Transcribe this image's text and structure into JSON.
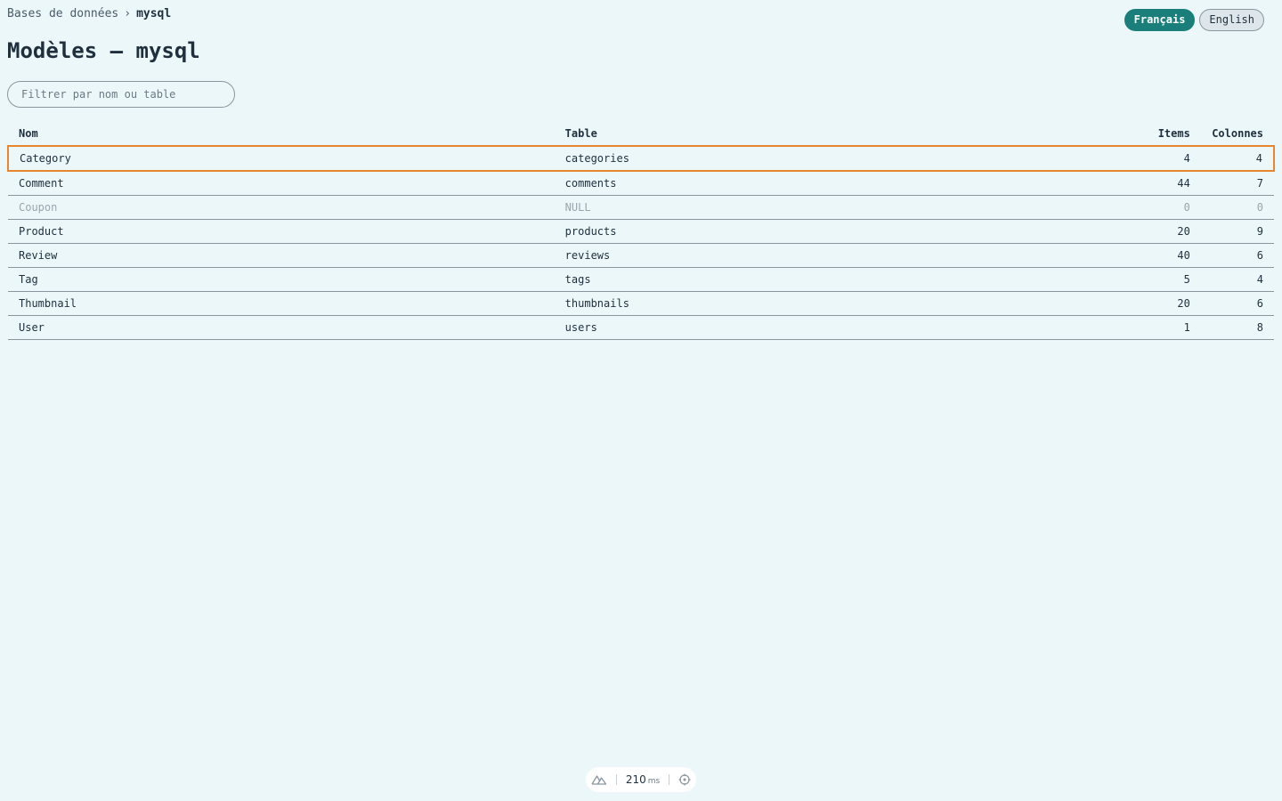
{
  "breadcrumb": {
    "root": "Bases de données",
    "separator": "›",
    "current": "mysql"
  },
  "languages": {
    "active": "Français",
    "other": "English"
  },
  "page_title": "Modèles — mysql",
  "filter": {
    "placeholder": "Filtrer par nom ou table",
    "value": ""
  },
  "table": {
    "headers": {
      "name": "Nom",
      "table": "Table",
      "items": "Items",
      "columns": "Colonnes"
    },
    "rows": [
      {
        "name": "Category",
        "table": "categories",
        "items": "4",
        "columns": "4"
      },
      {
        "name": "Comment",
        "table": "comments",
        "items": "44",
        "columns": "7"
      },
      {
        "name": "Coupon",
        "table": "NULL",
        "items": "0",
        "columns": "0"
      },
      {
        "name": "Product",
        "table": "products",
        "items": "20",
        "columns": "9"
      },
      {
        "name": "Review",
        "table": "reviews",
        "items": "40",
        "columns": "6"
      },
      {
        "name": "Tag",
        "table": "tags",
        "items": "5",
        "columns": "4"
      },
      {
        "name": "Thumbnail",
        "table": "thumbnails",
        "items": "20",
        "columns": "6"
      },
      {
        "name": "User",
        "table": "users",
        "items": "1",
        "columns": "8"
      }
    ]
  },
  "debug_bar": {
    "time": "210",
    "unit": "ms",
    "logo_icon": "nuxt-logo-icon",
    "inspect_icon": "crosshair-icon"
  },
  "colors": {
    "accent": "#1a7f7a",
    "selection": "#e8862f",
    "background": "#ebf7f9"
  }
}
